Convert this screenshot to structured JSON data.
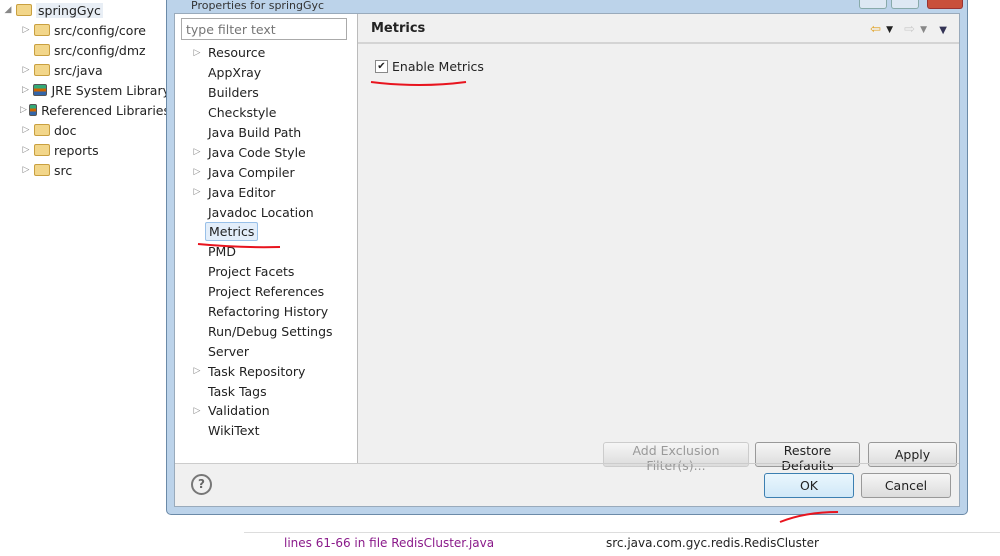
{
  "explorer": {
    "items": [
      {
        "label": "springGyc",
        "twisty": "open",
        "icon": "project-icon"
      },
      {
        "label": "src/config/core",
        "twisty": "closed",
        "icon": "package-folder-icon"
      },
      {
        "label": "src/config/dmz",
        "twisty": "",
        "icon": "package-folder-icon"
      },
      {
        "label": "src/java",
        "twisty": "closed",
        "icon": "package-folder-icon"
      },
      {
        "label": "JRE System Library",
        "twisty": "closed",
        "icon": "library-icon"
      },
      {
        "label": "Referenced Libraries",
        "twisty": "closed",
        "icon": "library-icon"
      },
      {
        "label": "doc",
        "twisty": "closed",
        "icon": "folder-icon"
      },
      {
        "label": "reports",
        "twisty": "closed",
        "icon": "folder-icon"
      },
      {
        "label": "src",
        "twisty": "closed",
        "icon": "package-folder-icon"
      }
    ]
  },
  "dialog": {
    "title": "Properties for springGyc",
    "filter_placeholder": "type filter text",
    "nav": [
      {
        "label": "Resource",
        "expand": true
      },
      {
        "label": "AppXray"
      },
      {
        "label": "Builders"
      },
      {
        "label": "Checkstyle"
      },
      {
        "label": "Java Build Path"
      },
      {
        "label": "Java Code Style",
        "expand": true
      },
      {
        "label": "Java Compiler",
        "expand": true
      },
      {
        "label": "Java Editor",
        "expand": true
      },
      {
        "label": "Javadoc Location"
      },
      {
        "label": "Metrics",
        "selected": true
      },
      {
        "label": "PMD"
      },
      {
        "label": "Project Facets"
      },
      {
        "label": "Project References"
      },
      {
        "label": "Refactoring History"
      },
      {
        "label": "Run/Debug Settings"
      },
      {
        "label": "Server"
      },
      {
        "label": "Task Repository",
        "expand": true
      },
      {
        "label": "Task Tags"
      },
      {
        "label": "Validation",
        "expand": true
      },
      {
        "label": "WikiText"
      }
    ],
    "page_title": "Metrics",
    "enable_metrics_label": "Enable Metrics",
    "enable_metrics_checked": true,
    "buttons": {
      "add_exclusion": "Add Exclusion Filter(s)...",
      "restore_defaults": "Restore Defaults",
      "apply": "Apply",
      "ok": "OK",
      "cancel": "Cancel"
    }
  },
  "background": {
    "row": {
      "description": "lines 61-66 in file RedisCluster.java",
      "resource": "src.java.com.gyc.redis.RedisCluster"
    }
  },
  "colors": {
    "annotation": "#e8141e",
    "selection": "#e3eefa"
  }
}
